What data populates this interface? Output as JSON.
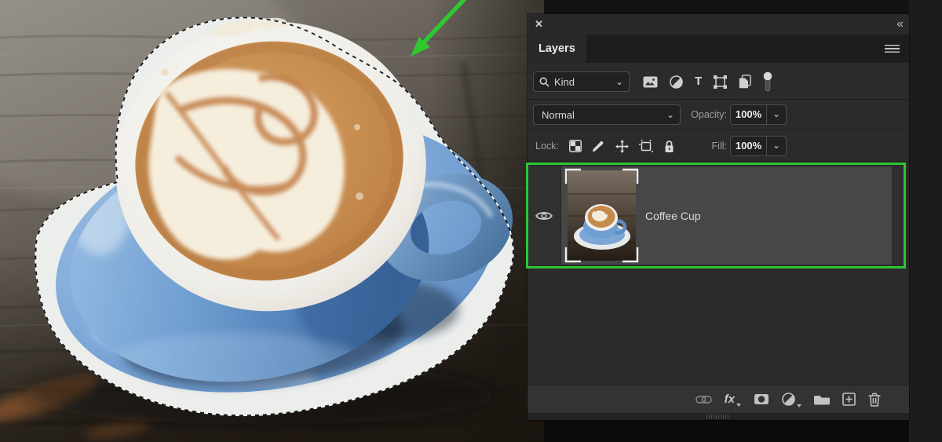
{
  "panel": {
    "header": {
      "close": "✕",
      "collapse": "«"
    },
    "tab": "Layers",
    "filter": {
      "search_label": "Kind",
      "type_glyph": "T",
      "icon_names": [
        "image-filter",
        "adjustment-filter",
        "type-filter",
        "shape-filter",
        "smart-object-filter",
        "filter-toggle"
      ]
    },
    "blend": {
      "mode": "Normal",
      "opacity_label": "Opacity:",
      "opacity_value": "100%"
    },
    "lock": {
      "label": "Lock:",
      "icon_names": [
        "lock-transparency",
        "lock-pixels",
        "lock-position",
        "lock-artboard",
        "lock-all"
      ],
      "fill_label": "Fill:",
      "fill_value": "100%"
    },
    "layers": [
      {
        "name": "Coffee Cup",
        "visible": true,
        "selected": true
      }
    ],
    "footer": {
      "fx": "fx",
      "icon_names": [
        "link",
        "fx",
        "add-mask",
        "adjustment",
        "group",
        "new-layer",
        "delete"
      ]
    },
    "highlight_color": "#2bc732"
  },
  "icons": {
    "chevron": "⌄"
  },
  "photo": {
    "subject": "blue cappuccino cup with latte art on a blue saucer on a weathered wood table",
    "selection": "marching-ants outline around cup and saucer",
    "arrow_color": "#2fc82f",
    "colors": {
      "cup_blue": "#6f9ed2",
      "saucer_blue": "#7fa9d8",
      "coffee": "#c08447",
      "foam": "#f6eedd",
      "rim_white": "#f0efeb",
      "wood_dark": "#3a332c",
      "wood_light": "#8d8882",
      "wood_orange": "#a4622d"
    }
  }
}
